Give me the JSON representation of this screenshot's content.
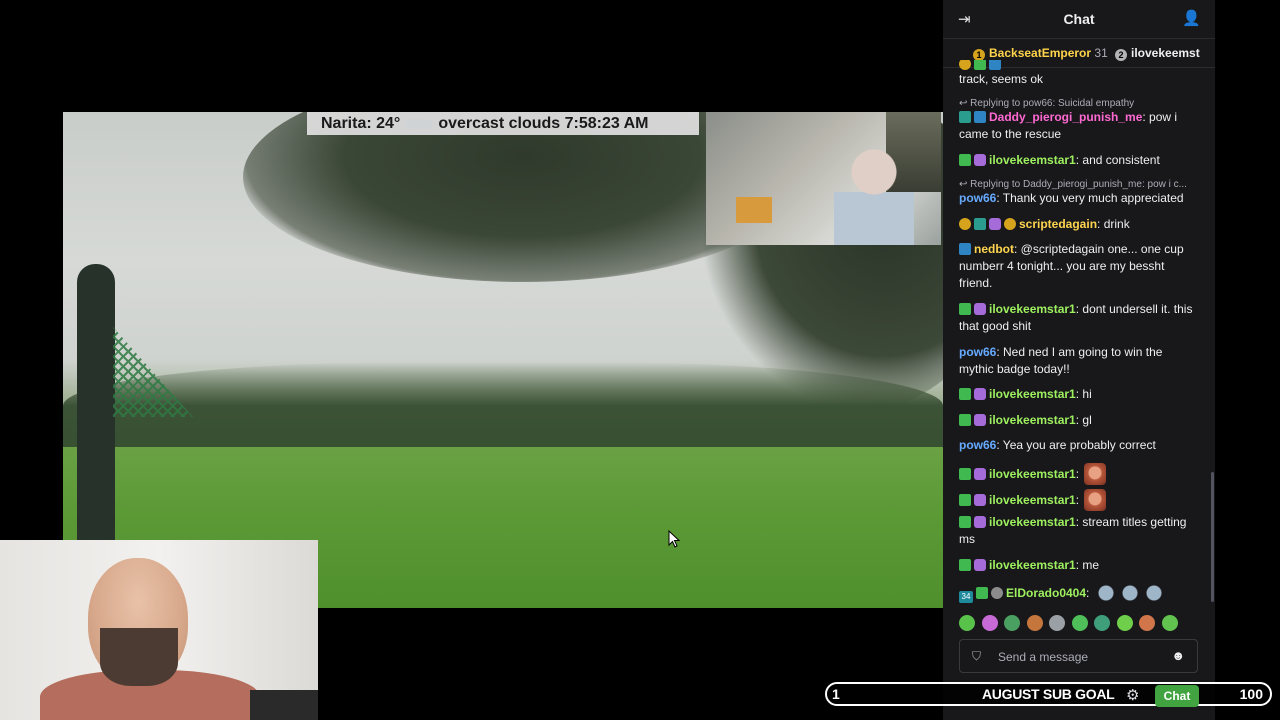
{
  "stream": {
    "weather_location": "Narita: 24°",
    "weather_text": "overcast clouds 7:58:23 AM"
  },
  "chat": {
    "title": "Chat",
    "leaderboard": [
      {
        "name": "BackseatEmperor",
        "count": "31",
        "rank_color": "#d6a31d"
      },
      {
        "name": "ilovekeemst",
        "count": "",
        "rank_color": "#b3b3b3"
      }
    ],
    "messages": [
      {
        "text_a": "track, seems ok"
      },
      {
        "reply": "Replying to pow66: Suicidal empathy",
        "user": "Daddy_pierogi_punish_me",
        "text": "pow i came to the rescue"
      },
      {
        "user": "ilovekeemstar1",
        "text": "and consistent"
      },
      {
        "reply": "Replying to Daddy_pierogi_punish_me: pow i c...",
        "user": "pow66",
        "text": "Thank you very much appreciated"
      },
      {
        "user": "scriptedagain",
        "text": "drink"
      },
      {
        "user": "nedbot",
        "text": "@scriptedagain one... one cup numberr 4 tonight... you are my bessht friend."
      },
      {
        "user": "ilovekeemstar1",
        "text": "dont undersell it. this that good shit"
      },
      {
        "user": "pow66",
        "text": "Ned ned I am going to win the mythic badge today!!"
      },
      {
        "user": "ilovekeemstar1",
        "text": "hi"
      },
      {
        "user": "ilovekeemstar1",
        "text": "gl"
      },
      {
        "user": "pow66",
        "text": "Yea you are probably correct"
      },
      {
        "user": "ilovekeemstar1",
        "text": ""
      },
      {
        "user": "ilovekeemstar1",
        "text": ""
      },
      {
        "user": "ilovekeemstar1",
        "text": "stream titles getting ms"
      },
      {
        "user": "ilovekeemstar1",
        "text": "me"
      },
      {
        "user": "ElDorado0404",
        "text": "",
        "badge_number": "34"
      }
    ],
    "input_placeholder": "Send a message",
    "send_label": "Chat"
  },
  "sub_goal": {
    "current": "1",
    "label": "AUGUST SUB GOAL",
    "target": "100"
  },
  "colors": {
    "chat_bg": "#18181b",
    "send_button": "#41a441",
    "username_green": "#9ef05f",
    "username_blue": "#66aaff"
  },
  "icons": [
    "collapse-icon",
    "users-icon",
    "shield-icon",
    "smile-icon",
    "gear-icon",
    "cursor-icon"
  ]
}
